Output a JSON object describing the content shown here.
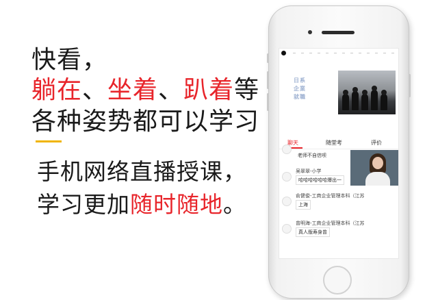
{
  "headline": {
    "line1": "快看，",
    "line2_red1": "躺在",
    "line2_sep1": "、",
    "line2_red2": "坐着",
    "line2_sep2": "、",
    "line2_red3": "趴着",
    "line2_tail": "等",
    "line3": "各种姿势都可以学习"
  },
  "subhead": {
    "line1": "手机网络直播授课，",
    "line2_start": "学习更加",
    "line2_red": "随时随地",
    "line2_end": "。"
  },
  "colors": {
    "accent_red": "#e8252b",
    "divider": "#f0b400"
  },
  "phone": {
    "banner_text": "日系 企業 就職",
    "tabs": [
      "聊天",
      "随堂考",
      "评价"
    ],
    "active_tab": "聊天",
    "chat": [
      {
        "name": "",
        "message": "老师不自信呗"
      },
      {
        "name": "吴翠翠-小学",
        "message": "哈哈哈哈哈哈爆出一"
      },
      {
        "name": "俞健俊-工商企业管理本科（江苏",
        "message": "上海"
      },
      {
        "name": "曾明海-工商企业管理本科（江苏",
        "message": "真人版寿身曾"
      }
    ]
  }
}
